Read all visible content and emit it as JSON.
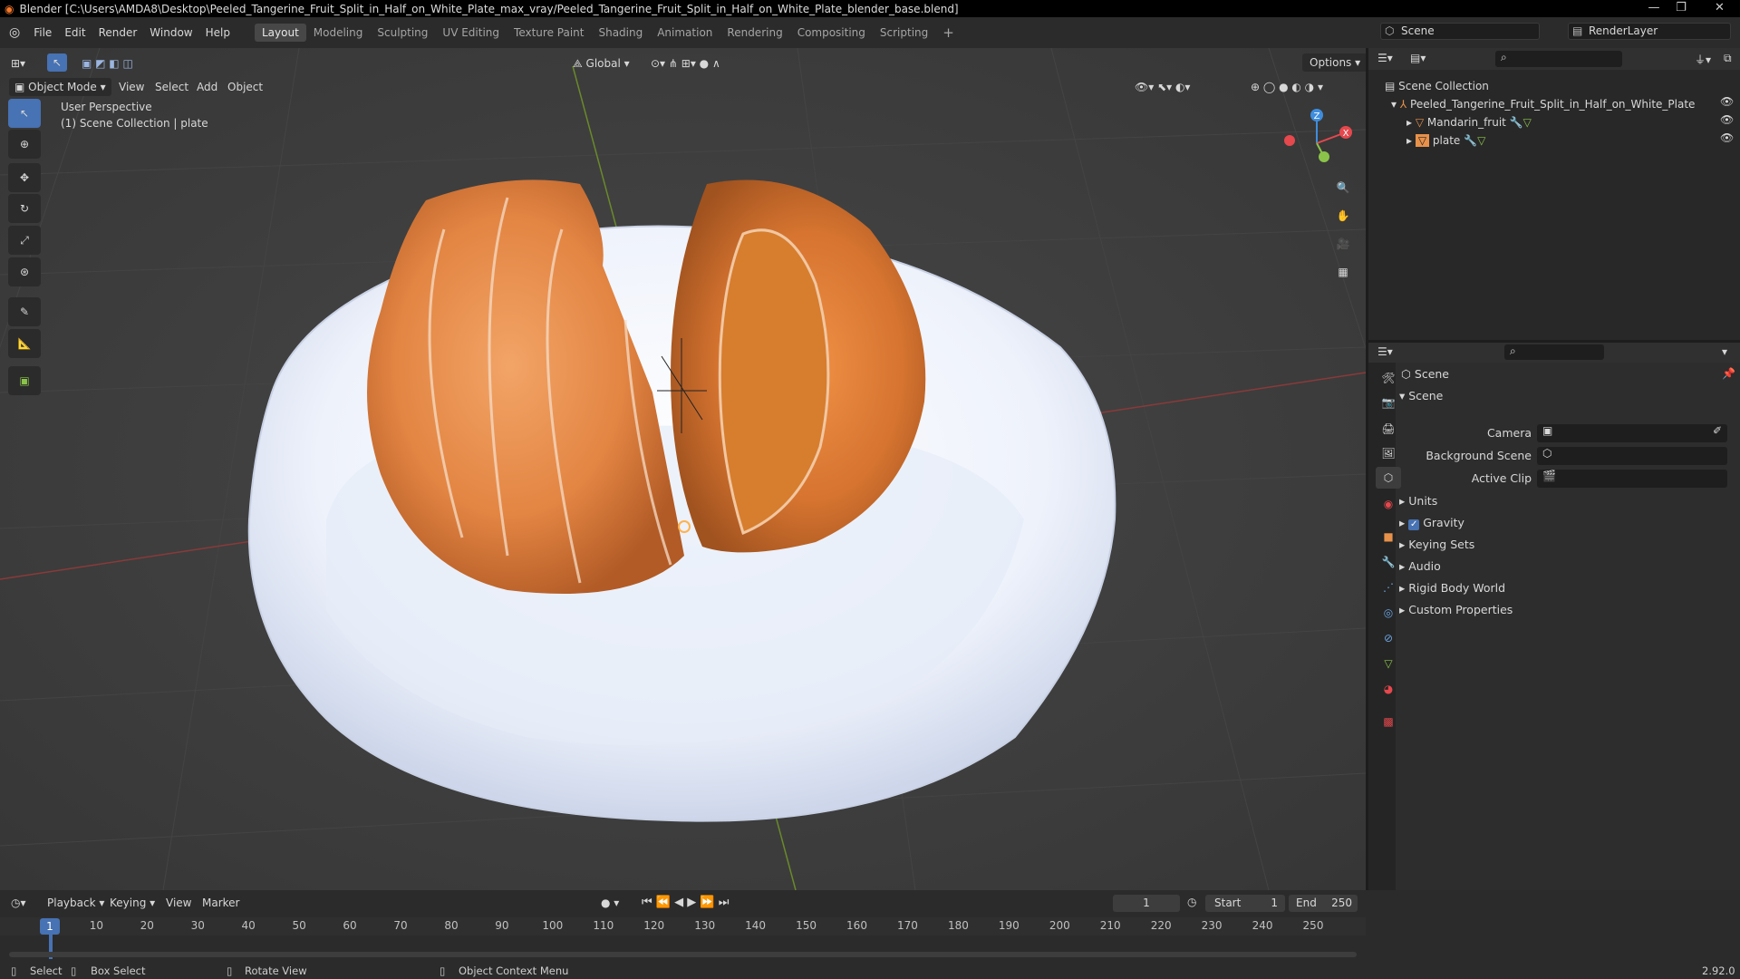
{
  "window": {
    "title": "Blender [C:\\Users\\AMDA8\\Desktop\\Peeled_Tangerine_Fruit_Split_in_Half_on_White_Plate_max_vray/Peeled_Tangerine_Fruit_Split_in_Half_on_White_Plate_blender_base.blend]"
  },
  "menus": [
    "File",
    "Edit",
    "Render",
    "Window",
    "Help"
  ],
  "workspaces": [
    {
      "label": "Layout",
      "active": true
    },
    {
      "label": "Modeling"
    },
    {
      "label": "Sculpting"
    },
    {
      "label": "UV Editing"
    },
    {
      "label": "Texture Paint"
    },
    {
      "label": "Shading"
    },
    {
      "label": "Animation"
    },
    {
      "label": "Rendering"
    },
    {
      "label": "Compositing"
    },
    {
      "label": "Scripting"
    }
  ],
  "scene_selector": {
    "label": "Scene"
  },
  "render_layer": {
    "label": "RenderLayer"
  },
  "viewport": {
    "mode": "Object Mode",
    "menus": [
      "View",
      "Select",
      "Add",
      "Object"
    ],
    "orientation": "Global",
    "options": "Options",
    "overlay_line1": "User Perspective",
    "overlay_line2": "(1) Scene Collection | plate",
    "gizmo_axes": {
      "z": "Z",
      "x": "X"
    }
  },
  "outliner": {
    "root": "Scene Collection",
    "collection": "Peeled_Tangerine_Fruit_Split_in_Half_on_White_Plate",
    "objects": [
      "Mandarin_fruit",
      "plate"
    ]
  },
  "properties": {
    "breadcrumb": "Scene",
    "panel": "Scene",
    "fields": {
      "camera": "Camera",
      "background_scene": "Background Scene",
      "active_clip": "Active Clip"
    },
    "sections": [
      "Units",
      "Gravity",
      "Keying Sets",
      "Audio",
      "Rigid Body World",
      "Custom Properties"
    ],
    "gravity_checked": true
  },
  "timeline": {
    "menus": [
      "Playback",
      "Keying",
      "View",
      "Marker"
    ],
    "current_frame": "1",
    "start_label": "Start",
    "start": "1",
    "end_label": "End",
    "end": "250",
    "ticks": [
      "1",
      "10",
      "20",
      "30",
      "40",
      "50",
      "60",
      "70",
      "80",
      "90",
      "100",
      "110",
      "120",
      "130",
      "140",
      "150",
      "160",
      "170",
      "180",
      "190",
      "200",
      "210",
      "220",
      "230",
      "240",
      "250"
    ]
  },
  "statusbar": {
    "select": "Select",
    "box_select": "Box Select",
    "rotate_view": "Rotate View",
    "context_menu": "Object Context Menu",
    "version": "2.92.0"
  },
  "colors": {
    "accent": "#4772b3",
    "x_axis": "#e5484d",
    "y_axis": "#8bc34a",
    "z_axis": "#3f8dde",
    "orange": "#e8914a"
  }
}
